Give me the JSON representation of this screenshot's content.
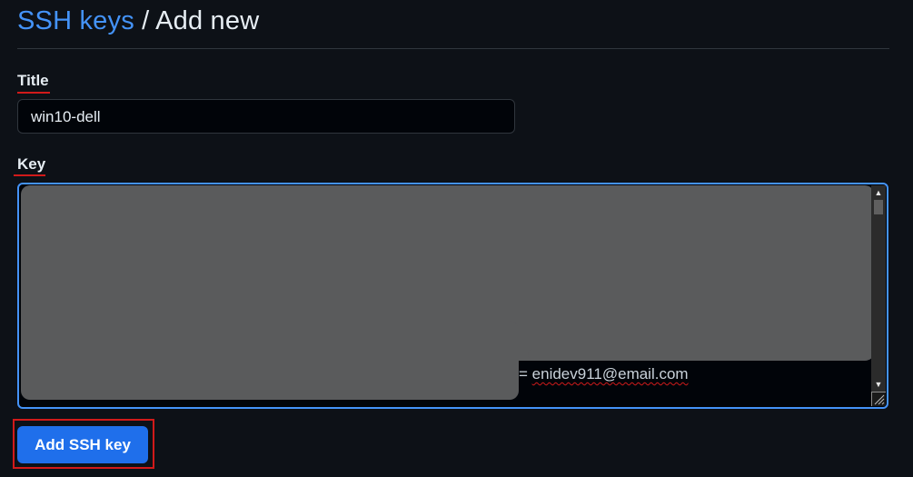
{
  "header": {
    "breadcrumb_link": "SSH keys",
    "separator": " / ",
    "current": "Add new"
  },
  "form": {
    "title_label": "Title",
    "title_value": "win10-dell",
    "key_label": "Key",
    "key_tail_prefix": "= ",
    "key_email": "enidev911@email.com",
    "submit_label": "Add SSH key"
  },
  "icons": {
    "scroll_up": "triangle-up",
    "scroll_down": "triangle-down",
    "resize": "resize-grip"
  },
  "colors": {
    "background": "#0d1117",
    "link": "#4493f8",
    "button": "#1f6feb",
    "annotation": "#d11a1a",
    "redaction": "#5a5b5c"
  }
}
